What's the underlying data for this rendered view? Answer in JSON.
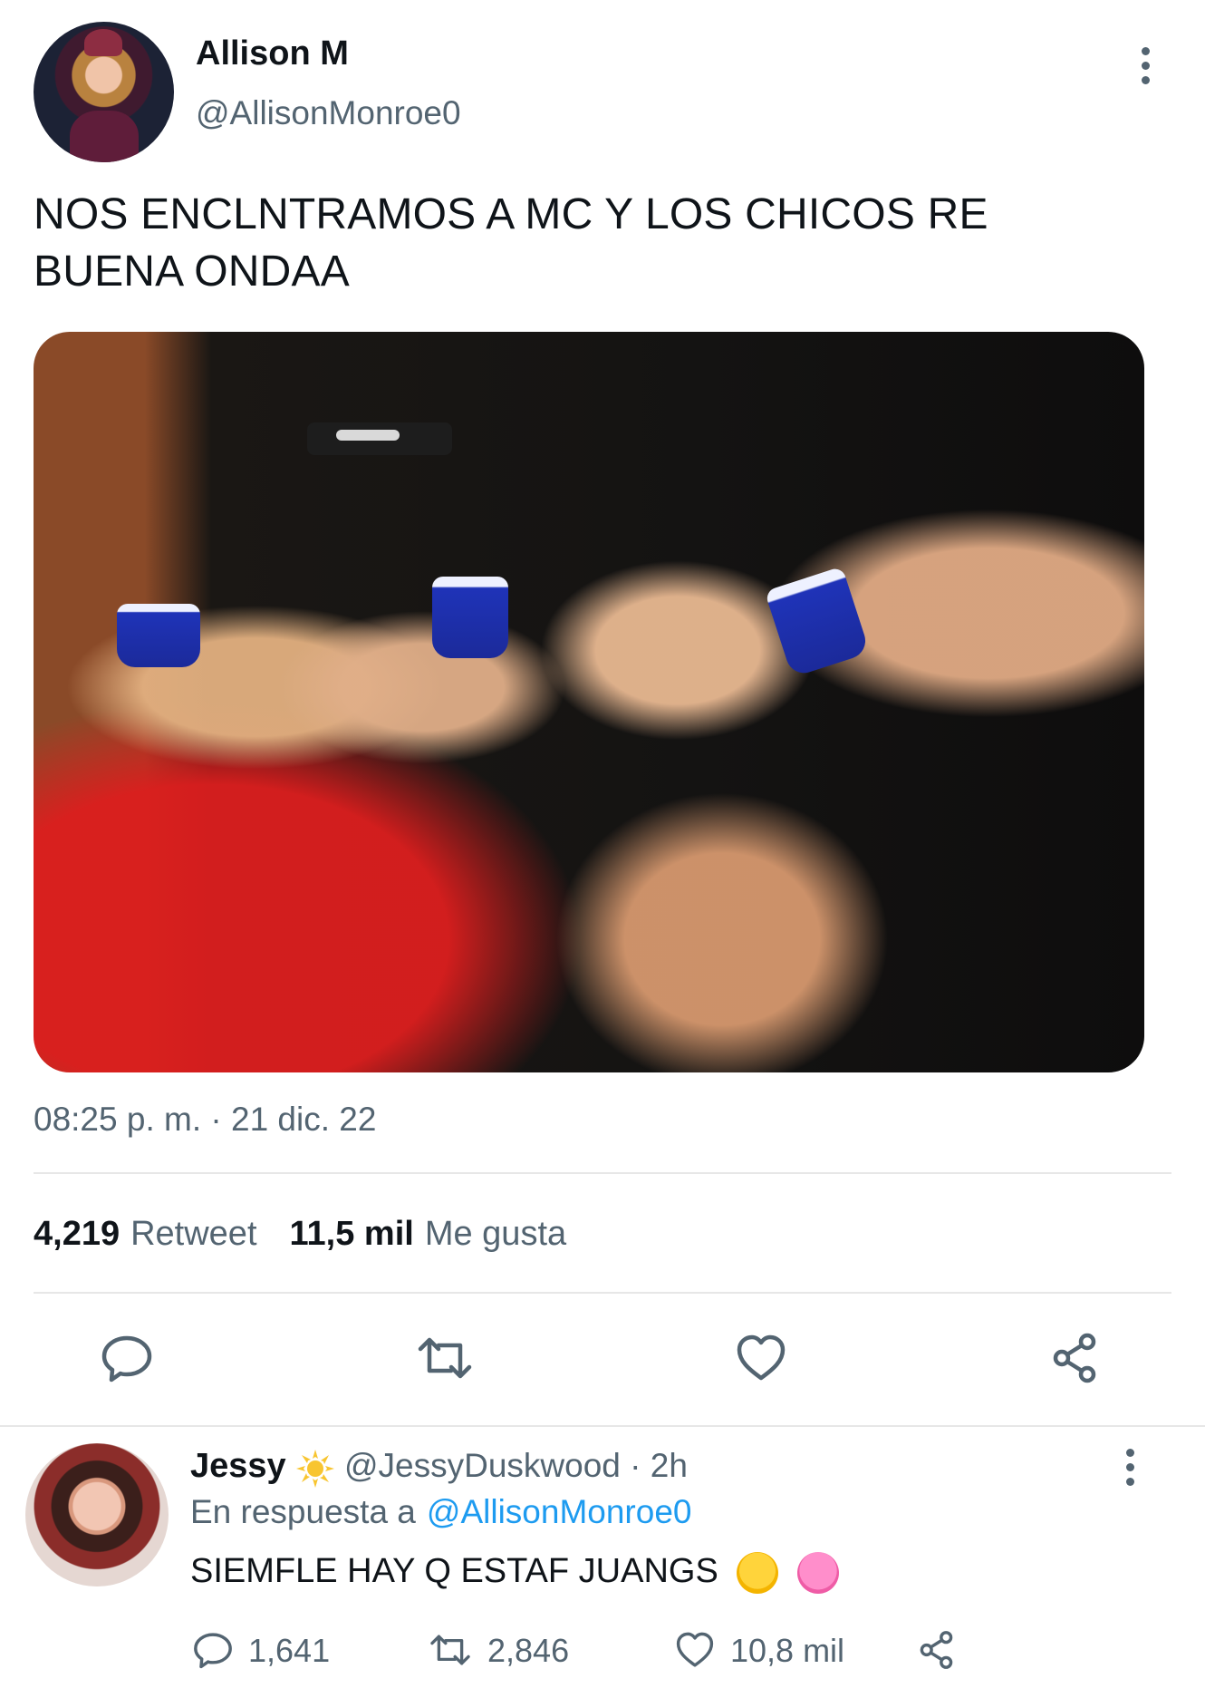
{
  "tweet": {
    "author_name": "Allison M",
    "author_handle": "@AllisonMonroe0",
    "text_line1": "NOS ENCLNTRAMOS A MC Y LOS CHICOS RE",
    "text_line2": "BUENA ONDAA",
    "timestamp": "08:25 p. m. · 21 dic. 22",
    "retweet_count": "4,219",
    "retweet_label": "Retweet",
    "like_count": "11,5 mil",
    "like_label": "Me gusta",
    "icons": [
      "reply-icon",
      "retweet-icon",
      "like-icon",
      "share-icon",
      "more-icon"
    ]
  },
  "reply": {
    "author_name": "Jessy",
    "author_handle": "@JessyDuskwood · 2h",
    "context_prefix": "En respuesta a",
    "context_mention": "@AllisonMonroe0",
    "text": "SIEMFLE HAY Q ESTAF JUANGS",
    "emoji": [
      "crying-face-emoji",
      "pink-heart-emoji"
    ],
    "reply_count": "1,641",
    "retweet_count": "2,846",
    "like_count": "10,8 mil"
  },
  "colors": {
    "text": "#0f1419",
    "muted": "#536471",
    "link": "#1d9bf0",
    "divider": "#e7e7e7"
  }
}
